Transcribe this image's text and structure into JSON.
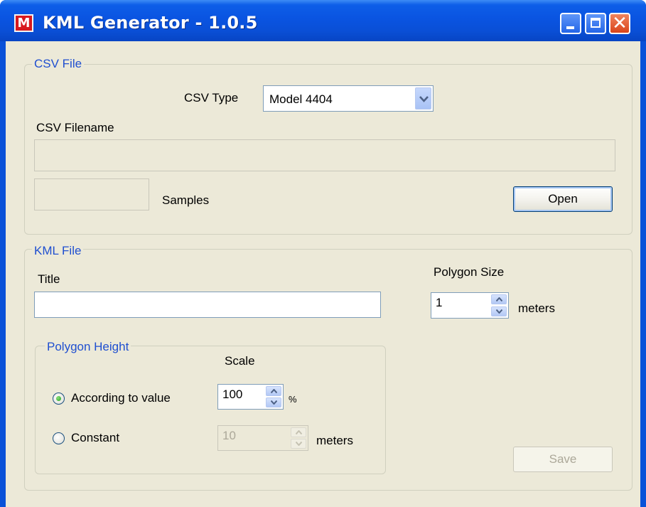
{
  "window": {
    "title": "KML Generator - 1.0.5",
    "icon": "app-logo-icon",
    "icon_text": "M",
    "minimize_icon": "minimize-icon",
    "maximize_icon": "maximize-icon",
    "close_icon": "close-icon",
    "close_glyph": "✕"
  },
  "csv_group": {
    "label": "CSV File",
    "csv_type_label": "CSV Type",
    "csv_type_value": "Model 4404",
    "csv_filename_label": "CSV Filename",
    "csv_filename_value": "",
    "samples_value": "",
    "samples_label": "Samples",
    "open_button": "Open"
  },
  "kml_group": {
    "label": "KML File",
    "title_label": "Title",
    "title_value": "",
    "polygon_size_label": "Polygon Size",
    "polygon_size_value": "1",
    "polygon_size_unit": "meters",
    "save_button": "Save"
  },
  "height_group": {
    "label": "Polygon Height",
    "scale_label": "Scale",
    "according_label": "According to value",
    "according_value": "100",
    "according_unit": "%",
    "constant_label": "Constant",
    "constant_value": "10",
    "constant_unit": "meters",
    "selected": "According to value"
  },
  "colors": {
    "titlebar": "#0a54e1",
    "client_bg": "#ece9d8",
    "group_label": "#1f4fd0",
    "close_button": "#d9441a"
  }
}
